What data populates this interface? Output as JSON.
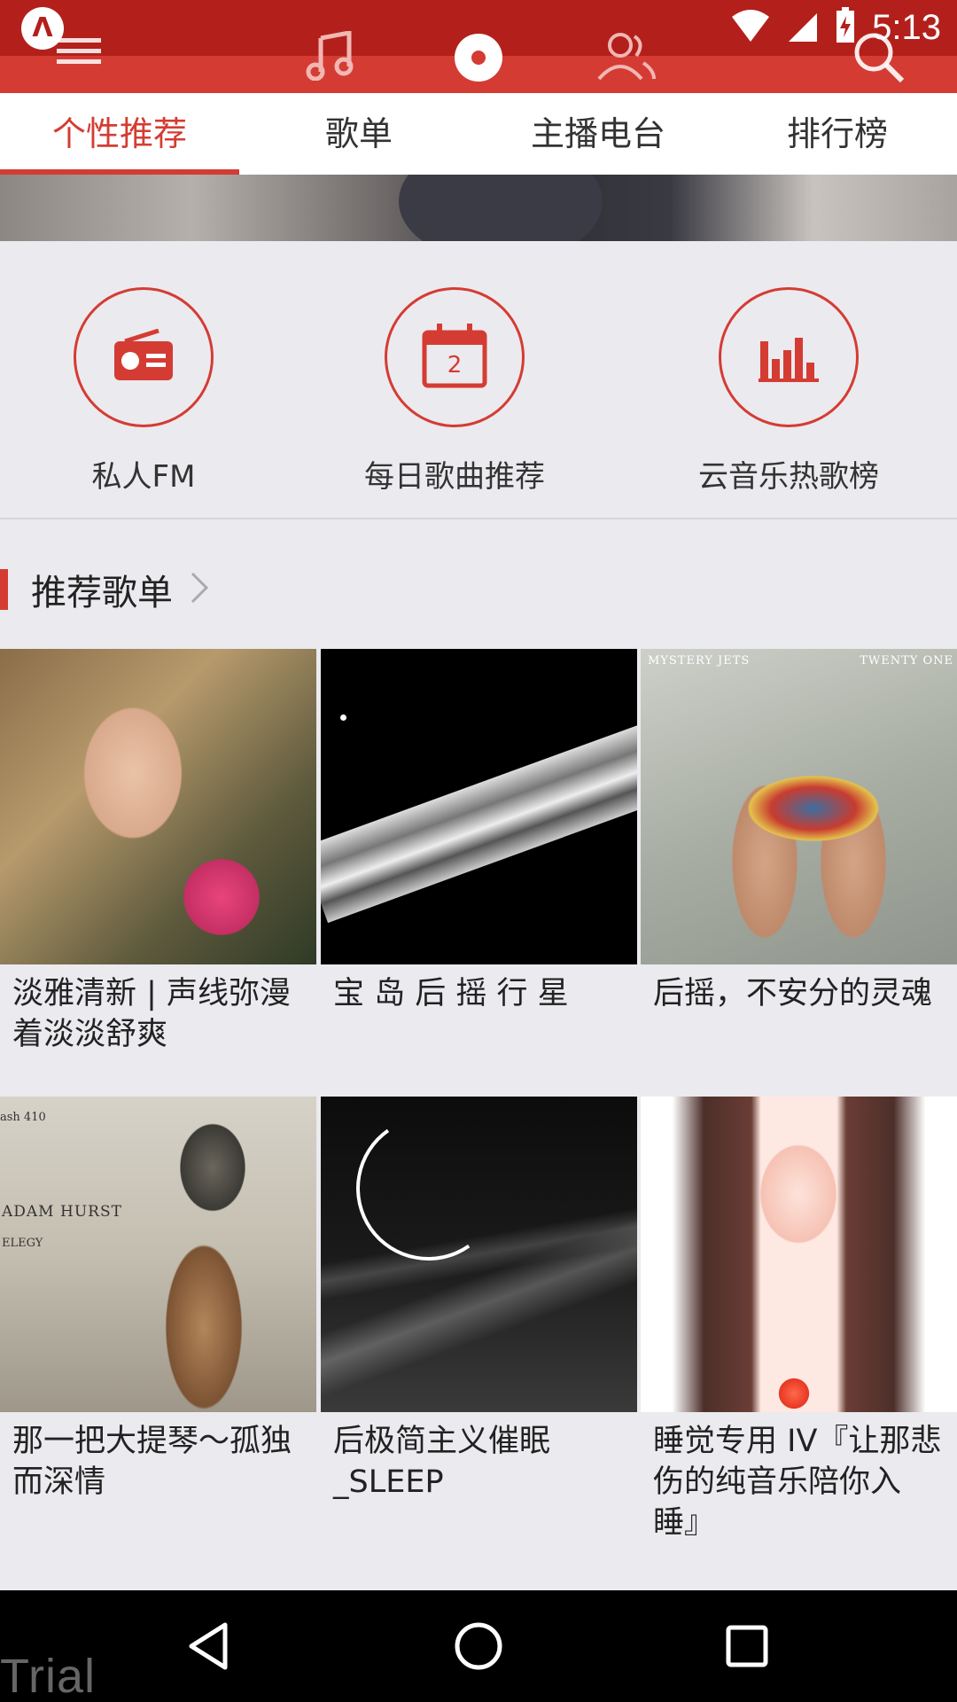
{
  "status_bar": {
    "time": "5:13",
    "app_badge": "Λ",
    "icons": [
      "wifi-icon",
      "signal-icon",
      "battery-charging-icon"
    ]
  },
  "toolbar": {
    "icons": [
      "menu-icon",
      "music-note-icon",
      "disc-icon",
      "friends-icon",
      "search-icon"
    ]
  },
  "tabs": [
    {
      "label": "个性推荐",
      "active": true
    },
    {
      "label": "歌单",
      "active": false
    },
    {
      "label": "主播电台",
      "active": false
    },
    {
      "label": "排行榜",
      "active": false
    }
  ],
  "features": [
    {
      "label": "私人FM",
      "icon": "radio-icon"
    },
    {
      "label": "每日歌曲推荐",
      "icon": "calendar-icon",
      "day": "2"
    },
    {
      "label": "云音乐热歌榜",
      "icon": "chart-bars-icon"
    }
  ],
  "section": {
    "title": "推荐歌单"
  },
  "playlists": [
    {
      "title": "淡雅清新 | 声线弥漫着淡淡舒爽",
      "cover": "girl-with-flowers"
    },
    {
      "title": "宝 岛 后 摇 行 星",
      "cover": "saturn-rings"
    },
    {
      "title": "后摇，不安分的灵魂",
      "cover": "bound-feet",
      "cover_text_left": "MYSTERY JETS",
      "cover_text_right": "TWENTY ONE"
    },
    {
      "title": "那一把大提琴～孤独而深情",
      "cover": "cellist",
      "cover_text_top": "ash 410",
      "cover_text_name": "ADAM HURST",
      "cover_text_album": "ELEGY"
    },
    {
      "title": "后极简主义催眠_SLEEP",
      "cover": "eclipse-waves"
    },
    {
      "title": "睡觉专用 IV『让那悲伤的纯音乐陪你入睡』",
      "cover": "anime-girl-heart"
    }
  ],
  "watermark": "Trial",
  "colors": {
    "accent": "#d43c33",
    "status_bar": "#b3201b",
    "background": "#ebeaef"
  }
}
